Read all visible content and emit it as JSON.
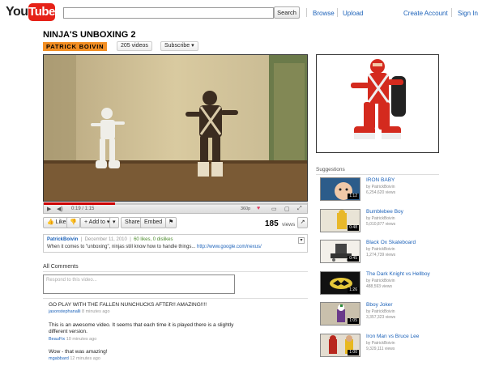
{
  "header": {
    "logo_you": "You",
    "logo_tube": "Tube",
    "search_placeholder": "",
    "search_button": "Search",
    "browse": "Browse",
    "upload": "Upload",
    "create_account": "Create Account",
    "sign_in": "Sign In"
  },
  "video": {
    "title": "NINJA'S UNBOXING 2",
    "channel": "PATRICK BOIVIN",
    "videos_count": "205 videos",
    "subscribe": "Subscribe",
    "time": "0:19 / 1:15",
    "quality": "360p",
    "progress": 0.27,
    "views_count": "185",
    "views_label": "views"
  },
  "actions": {
    "like": "Like",
    "add_to": "+ Add to",
    "share": "Share",
    "embed": "Embed"
  },
  "description": {
    "author": "PatrickBoivin",
    "date": "December 11, 2010",
    "likes": "60 likes, 0 dislikes",
    "text": "When it comes to \"unboxing\", ninjas still know how to handle things...",
    "link": "http://www.google.com/nexus/"
  },
  "comments": {
    "header": "All Comments",
    "placeholder": "Respond to this video...",
    "items": [
      {
        "text": "GO PLAY WITH THE FALLEN NUNCHUCKS AFTER!! AMAZING!!!!",
        "user": "jasonstephanalli",
        "age": "8 minutes ago"
      },
      {
        "text": "This is an awesome video. It seems that each time it is played there is a slightly different version.",
        "user": "BeauFix",
        "age": "10 minutes ago"
      },
      {
        "text": "Wow - that was amazing!",
        "user": "mgabbard",
        "age": "12 minutes ago"
      }
    ]
  },
  "suggestions": {
    "header": "Suggestions",
    "items": [
      {
        "title": "IRON BABY",
        "by": "by PatrickBoivin",
        "views": "6,254,620 views",
        "duration": "1:12"
      },
      {
        "title": "Bumblebee Boy",
        "by": "by PatrickBoivin",
        "views": "5,010,877 views",
        "duration": "0:48"
      },
      {
        "title": "Black Ox Skateboard",
        "by": "by PatrickBoivin",
        "views": "1,274,739 views",
        "duration": "0:45"
      },
      {
        "title": "The Dark Knight vs Hellboy",
        "by": "by PatrickBoivin",
        "views": "488,593 views",
        "duration": "1:26"
      },
      {
        "title": "Bboy Joker",
        "by": "by PatrickBoivin",
        "views": "3,357,323 views",
        "duration": "1:05"
      },
      {
        "title": "Iron Man vs Bruce Lee",
        "by": "by PatrickBoivin",
        "views": "9,329,111 views",
        "duration": "1:00"
      }
    ]
  },
  "colors": {
    "accent": "#1c62b9",
    "channel_badge": "#f28e22",
    "logo_red": "#e62117"
  },
  "icons": [
    "play-icon",
    "volume-icon",
    "heart-icon",
    "fullscreen-icon",
    "dislike-icon",
    "flag-icon",
    "stats-icon",
    "expand-icon"
  ]
}
